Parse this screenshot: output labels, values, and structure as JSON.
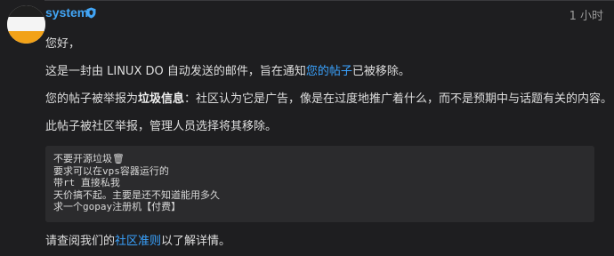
{
  "post": {
    "username": "system",
    "timestamp": "1 小时",
    "greeting": "您好，",
    "intro_before": "这是一封由 LINUX DO 自动发送的邮件，旨在通知",
    "intro_link": "您的帖子",
    "intro_after": "已被移除。",
    "report_before": "您的帖子被举报为",
    "report_strong": "垃圾信息",
    "report_after": "：社区认为它是广告，像是在过度地推广着什么，而不是预期中与话题有关的内容。",
    "action_text": "此帖子被社区举报，管理人员选择将其移除。",
    "quoted_lines": [
      "不要开源垃圾🗑",
      "要求可以在vps容器运行的",
      "带rt 直接私我",
      "天价搞不起。主要是还不知道能用多久",
      "求一个gopay注册机【付费】"
    ],
    "footer_before": "请查阅我们的",
    "footer_link": "社区准则",
    "footer_after": "以了解详情。"
  },
  "colors": {
    "background": "#1e1e20",
    "username": "#42a5f5",
    "link": "#3aa3ff",
    "code_background": "#2b2b2d"
  },
  "icons": {
    "badge": "shield-icon"
  }
}
